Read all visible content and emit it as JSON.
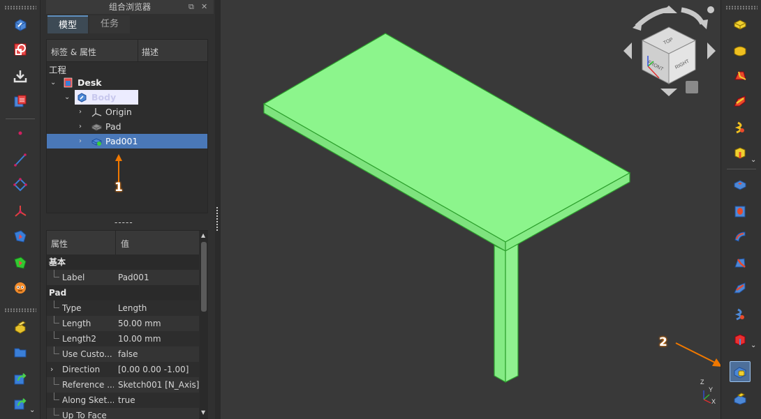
{
  "combo_view": {
    "title": "组合浏览器",
    "tabs": [
      {
        "label": "模型"
      },
      {
        "label": "任务"
      }
    ]
  },
  "tree": {
    "headers": [
      "标签 & 属性",
      "描述"
    ],
    "root_label": "工程",
    "items": [
      {
        "label": "Desk",
        "icon": "document-icon"
      },
      {
        "label": "Body",
        "icon": "body-icon"
      },
      {
        "label": "Origin",
        "icon": "origin-axes-icon"
      },
      {
        "label": "Pad",
        "icon": "pad-icon"
      },
      {
        "label": "Pad001",
        "icon": "pad-icon"
      }
    ]
  },
  "splitter_text": "-----",
  "properties": {
    "headers": [
      "属性",
      "值"
    ],
    "groups": [
      {
        "name": "基本",
        "rows": [
          {
            "key": "Label",
            "value": "Pad001"
          }
        ]
      },
      {
        "name": "Pad",
        "rows": [
          {
            "key": "Type",
            "value": "Length"
          },
          {
            "key": "Length",
            "value": "50.00 mm"
          },
          {
            "key": "Length2",
            "value": "10.00 mm"
          },
          {
            "key": "Use Custo...",
            "value": "false"
          },
          {
            "key": "Direction",
            "value": "[0.00 0.00 -1.00]"
          },
          {
            "key": "Reference ...",
            "value": "Sketch001 [N_Axis]"
          },
          {
            "key": "Along Sket...",
            "value": "true"
          },
          {
            "key": "Up To Face",
            "value": ""
          }
        ]
      }
    ]
  },
  "viewport": {
    "model_color": "#8cf58c",
    "edge_color": "#2ea02e",
    "background": "#393939",
    "navcube_faces": [
      "TOP",
      "FRONT",
      "RIGHT"
    ],
    "axis_labels": [
      "Z",
      "Y",
      "X"
    ]
  },
  "callouts": [
    "1",
    "2"
  ],
  "colors": {
    "accent": "#f07800",
    "selection": "#4a78b8"
  }
}
